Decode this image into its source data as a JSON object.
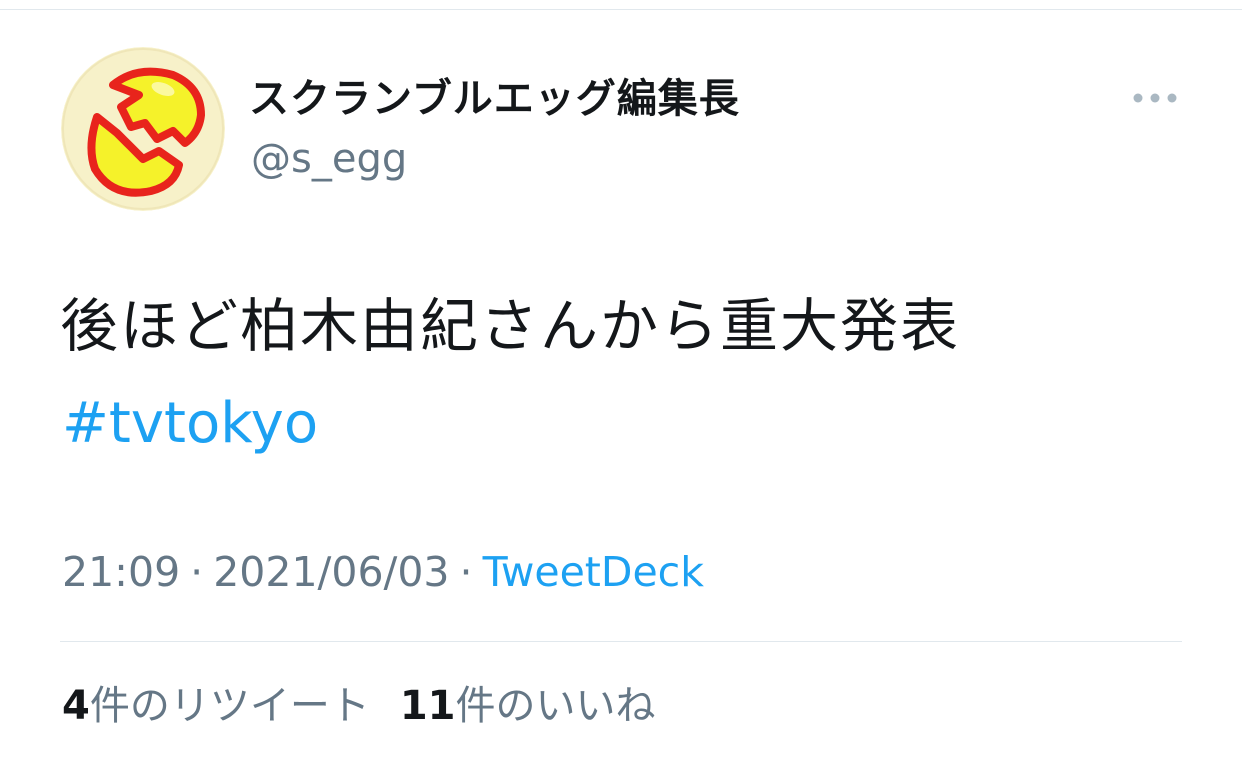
{
  "tweet": {
    "author": {
      "display_name": "スクランブルエッグ編集長",
      "handle": "@s_egg",
      "avatar_icon": "cracked-egg-logo"
    },
    "more_icon": "ellipsis-icon",
    "text": "後ほど柏木由紀さんから重大発表",
    "hashtag": "#tvtokyo",
    "time": "21:09",
    "date": "2021/06/03",
    "separator": "·",
    "source": "TweetDeck",
    "stats": {
      "retweets": {
        "count": "4",
        "label": "件のリツイート"
      },
      "likes": {
        "count": "11",
        "label": "件のいいね"
      }
    }
  },
  "colors": {
    "text": "#14171a",
    "secondary": "#657786",
    "link": "#1da1f2",
    "divider": "#e1e8ed",
    "avatar_bg": "#f7f1c9",
    "egg_yellow": "#f5f22a",
    "egg_red": "#e8241c"
  }
}
